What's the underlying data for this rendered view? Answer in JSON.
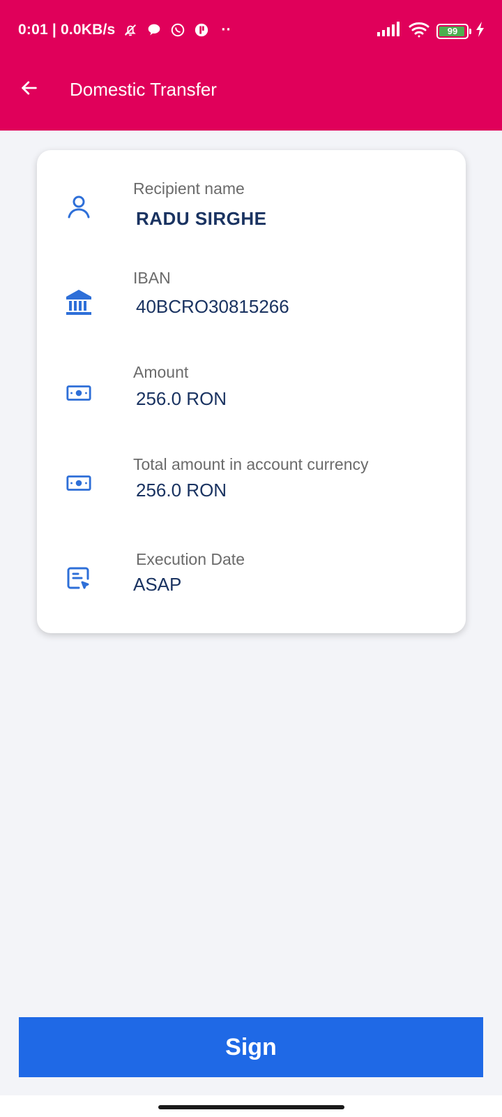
{
  "status_bar": {
    "time_speed": "0:01 | 0.0KB/s",
    "battery_level": "99",
    "icons": [
      "mute-bell-icon",
      "chat-bubble-icon",
      "whatsapp-icon",
      "app-notification-icon",
      "more-dots-icon",
      "signal-icon",
      "wifi-icon",
      "battery-icon",
      "charging-icon"
    ],
    "more_dots": "··"
  },
  "toolbar": {
    "title": "Domestic Transfer",
    "back_icon": "arrow-left-icon"
  },
  "details": {
    "recipient": {
      "label": "Recipient name",
      "value": "RADU SIRGHE",
      "icon": "person-icon"
    },
    "iban": {
      "label": "IBAN",
      "value": "40BCRO30815266",
      "icon": "bank-icon"
    },
    "amount": {
      "label": "Amount",
      "value": "256.0 RON",
      "icon": "banknote-icon"
    },
    "total_amount": {
      "label": "Total amount in account currency",
      "value": "256.0 RON",
      "icon": "banknote-icon"
    },
    "execution_date": {
      "label": "Execution Date",
      "value": "ASAP",
      "icon": "calendar-pointer-icon"
    }
  },
  "actions": {
    "sign_label": "Sign"
  },
  "colors": {
    "header_bg": "#e0005a",
    "page_bg": "#f3f4f8",
    "primary_button": "#1f69e6",
    "value_text": "#1a3361",
    "label_text": "#6b6b6b",
    "icon_blue": "#2e6fd8"
  }
}
